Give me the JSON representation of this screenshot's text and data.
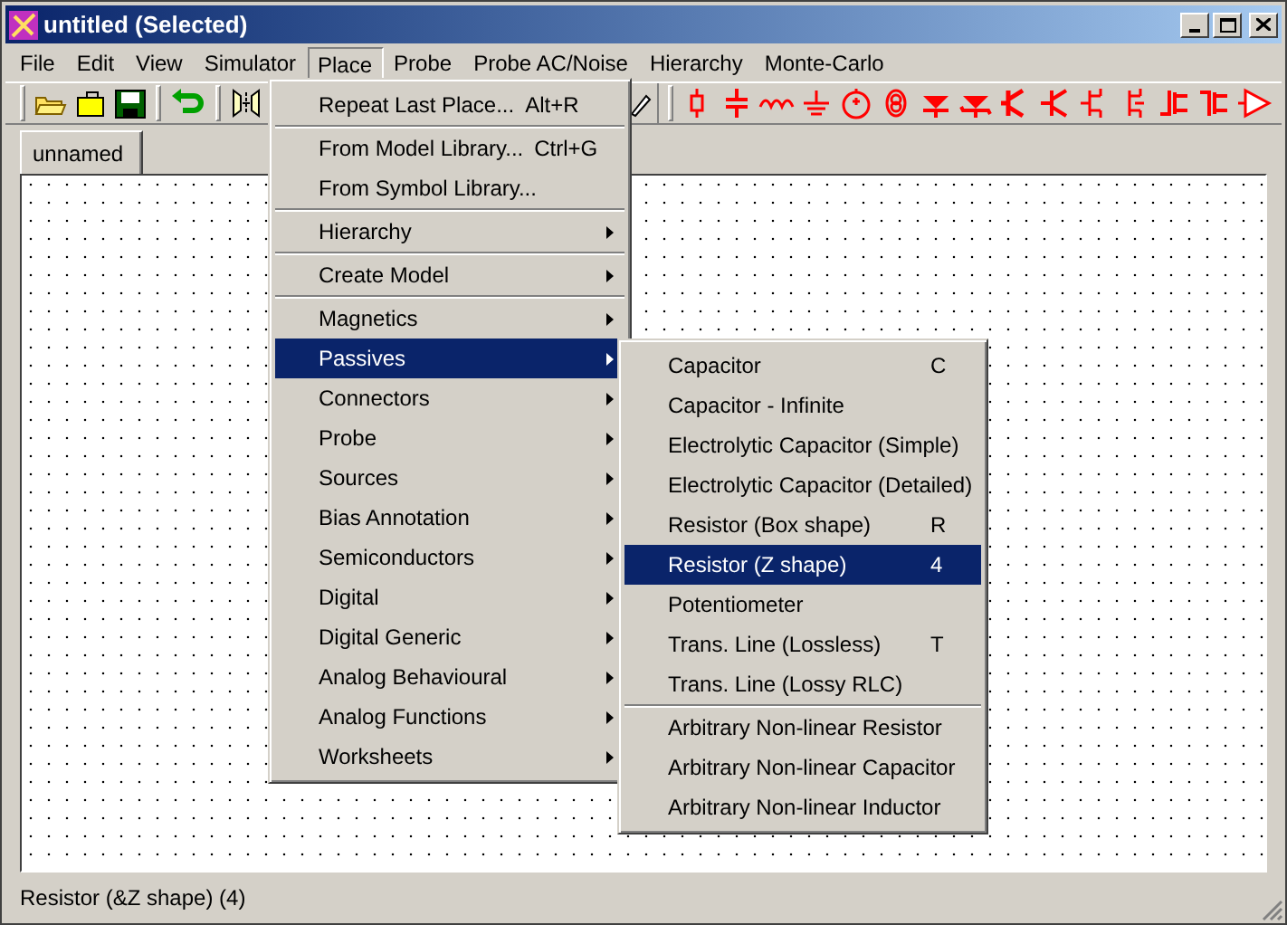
{
  "window": {
    "title": "untitled (Selected)"
  },
  "menu_bar": [
    {
      "label": "File",
      "selected": false
    },
    {
      "label": "Edit",
      "selected": false
    },
    {
      "label": "View",
      "selected": false
    },
    {
      "label": "Simulator",
      "selected": false
    },
    {
      "label": "Place",
      "selected": true
    },
    {
      "label": "Probe",
      "selected": false
    },
    {
      "label": "Probe AC/Noise",
      "selected": false
    },
    {
      "label": "Hierarchy",
      "selected": false
    },
    {
      "label": "Monte-Carlo",
      "selected": false
    }
  ],
  "tabs": [
    {
      "label": "unnamed",
      "selected": true
    }
  ],
  "place_menu": [
    {
      "kind": "item",
      "label": "Repeat Last Place...",
      "shortcut": "Alt+R",
      "submenu": false,
      "selected": false
    },
    {
      "kind": "separator"
    },
    {
      "kind": "item",
      "label": "From Model Library...",
      "shortcut": "Ctrl+G",
      "submenu": false,
      "selected": false
    },
    {
      "kind": "item",
      "label": "From Symbol Library...",
      "submenu": false,
      "selected": false
    },
    {
      "kind": "separator"
    },
    {
      "kind": "item",
      "label": "Hierarchy",
      "submenu": true,
      "selected": false
    },
    {
      "kind": "separator"
    },
    {
      "kind": "item",
      "label": "Create Model",
      "submenu": true,
      "selected": false
    },
    {
      "kind": "separator"
    },
    {
      "kind": "item",
      "label": "Magnetics",
      "submenu": true,
      "selected": false
    },
    {
      "kind": "item",
      "label": "Passives",
      "submenu": true,
      "selected": true
    },
    {
      "kind": "item",
      "label": "Connectors",
      "submenu": true,
      "selected": false
    },
    {
      "kind": "item",
      "label": "Probe",
      "submenu": true,
      "selected": false
    },
    {
      "kind": "item",
      "label": "Sources",
      "submenu": true,
      "selected": false
    },
    {
      "kind": "item",
      "label": "Bias Annotation",
      "submenu": true,
      "selected": false
    },
    {
      "kind": "item",
      "label": "Semiconductors",
      "submenu": true,
      "selected": false
    },
    {
      "kind": "item",
      "label": "Digital",
      "submenu": true,
      "selected": false
    },
    {
      "kind": "item",
      "label": "Digital Generic",
      "submenu": true,
      "selected": false
    },
    {
      "kind": "item",
      "label": "Analog Behavioural",
      "submenu": true,
      "selected": false
    },
    {
      "kind": "item",
      "label": "Analog Functions",
      "submenu": true,
      "selected": false
    },
    {
      "kind": "item",
      "label": "Worksheets",
      "submenu": true,
      "selected": false
    }
  ],
  "passives_menu": [
    {
      "kind": "item",
      "label": "Capacitor",
      "shortcut": "C",
      "selected": false
    },
    {
      "kind": "item",
      "label": "Capacitor - Infinite",
      "selected": false
    },
    {
      "kind": "item",
      "label": "Electrolytic Capacitor (Simple)",
      "selected": false
    },
    {
      "kind": "item",
      "label": "Electrolytic Capacitor (Detailed)",
      "selected": false
    },
    {
      "kind": "item",
      "label": "Resistor (Box shape)",
      "shortcut": "R",
      "selected": false
    },
    {
      "kind": "item",
      "label": "Resistor (Z shape)",
      "shortcut": "4",
      "selected": true
    },
    {
      "kind": "item",
      "label": "Potentiometer",
      "selected": false
    },
    {
      "kind": "item",
      "label": "Trans. Line (Lossless)",
      "shortcut": "T",
      "selected": false
    },
    {
      "kind": "item",
      "label": "Trans. Line (Lossy RLC)",
      "selected": false
    },
    {
      "kind": "separator"
    },
    {
      "kind": "item",
      "label": "Arbitrary Non-linear Resistor",
      "selected": false
    },
    {
      "kind": "item",
      "label": "Arbitrary Non-linear Capacitor",
      "selected": false
    },
    {
      "kind": "item",
      "label": "Arbitrary Non-linear Inductor",
      "selected": false
    }
  ],
  "status_bar": {
    "text": "Resistor (&Z shape) (4)"
  }
}
